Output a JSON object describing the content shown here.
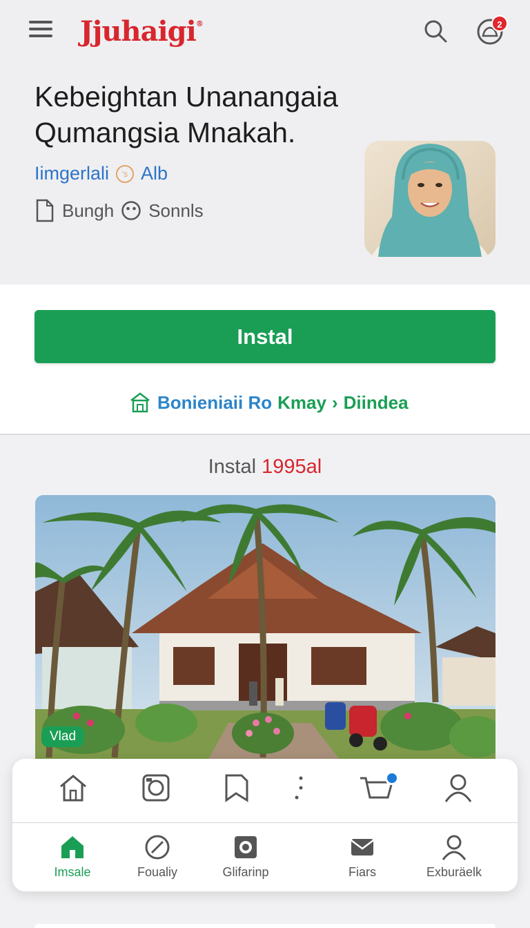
{
  "header": {
    "logo": "Jjuhaigi",
    "logo_mark": "®",
    "notification_count": "2"
  },
  "profile": {
    "title_line1": "Kebeightan Unanangaia",
    "title_line2": "Qumangsia Mnakah.",
    "sub_left": "Iimgerlali",
    "sub_icon": "ʹs",
    "sub_right": "Alb",
    "meta_left": "Bungh",
    "meta_right": "Sonnls",
    "avatar_icon": "person-photo"
  },
  "cta": {
    "install_label": "Instal",
    "link_part1": "Bonieniaii Ro",
    "link_part2": "Kmay",
    "link_arrow": "›",
    "link_part3": "Diindea"
  },
  "section": {
    "title_prefix": "Instal",
    "title_highlight": "1995al",
    "hero_tag": "Vlad"
  },
  "quick_actions": {
    "icons": [
      "home-outline-icon",
      "camera-icon",
      "bookmark-icon",
      "dots-icon",
      "cart-icon",
      "user-icon"
    ]
  },
  "nav": {
    "items": [
      {
        "label": "Imsale",
        "icon": "home-icon"
      },
      {
        "label": "Foualiy",
        "icon": "compass-icon"
      },
      {
        "label": "Glifarinp",
        "icon": "gear-icon"
      },
      {
        "label": "Fiars",
        "icon": "mail-icon"
      },
      {
        "label": "Exburäelk",
        "icon": "profile-icon"
      }
    ]
  },
  "colors": {
    "brand_red": "#d8262e",
    "primary_green": "#1a9e55",
    "link_blue": "#2c85c9"
  }
}
